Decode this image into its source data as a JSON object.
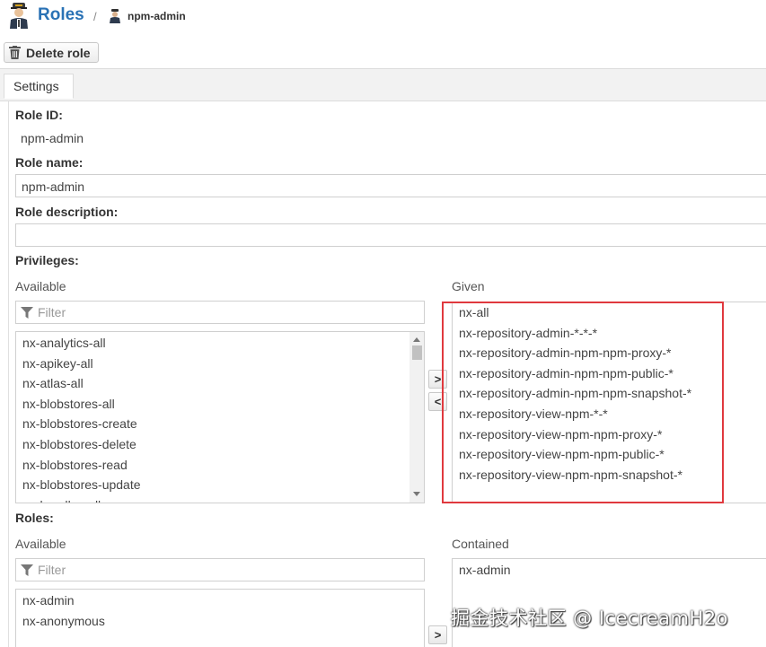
{
  "header": {
    "title": "Roles",
    "separator": "/",
    "current": "npm-admin"
  },
  "toolbar": {
    "delete_label": "Delete role"
  },
  "tabs": [
    {
      "label": "Settings",
      "active": true
    }
  ],
  "form": {
    "role_id": {
      "label": "Role ID:",
      "value": "npm-admin"
    },
    "role_name": {
      "label": "Role name:",
      "value": "npm-admin"
    },
    "role_description": {
      "label": "Role description:",
      "value": ""
    },
    "privileges": {
      "label": "Privileges:",
      "available_label": "Available",
      "given_label": "Given",
      "filter_placeholder": "Filter",
      "available": [
        "nx-analytics-all",
        "nx-apikey-all",
        "nx-atlas-all",
        "nx-blobstores-all",
        "nx-blobstores-create",
        "nx-blobstores-delete",
        "nx-blobstores-read",
        "nx-blobstores-update",
        "nx-bundles-all"
      ],
      "given": [
        "nx-all",
        "nx-repository-admin-*-*-*",
        "nx-repository-admin-npm-npm-proxy-*",
        "nx-repository-admin-npm-npm-public-*",
        "nx-repository-admin-npm-npm-snapshot-*",
        "nx-repository-view-npm-*-*",
        "nx-repository-view-npm-npm-proxy-*",
        "nx-repository-view-npm-npm-public-*",
        "nx-repository-view-npm-npm-snapshot-*"
      ],
      "add_button": ">",
      "remove_button": "<"
    },
    "roles": {
      "label": "Roles:",
      "available_label": "Available",
      "contained_label": "Contained",
      "filter_placeholder": "Filter",
      "available": [
        "nx-admin",
        "nx-anonymous"
      ],
      "contained": [
        "nx-admin"
      ],
      "add_button": ">"
    }
  },
  "icons": {
    "avatar": "admin-user-icon",
    "breadcrumb": "user-icon",
    "delete": "trash-icon",
    "filter": "funnel-icon"
  },
  "colors": {
    "title": "#2a72b5",
    "highlight_box": "#e0393e"
  },
  "watermark": "掘金技术社区 @ IcecreamH2o"
}
